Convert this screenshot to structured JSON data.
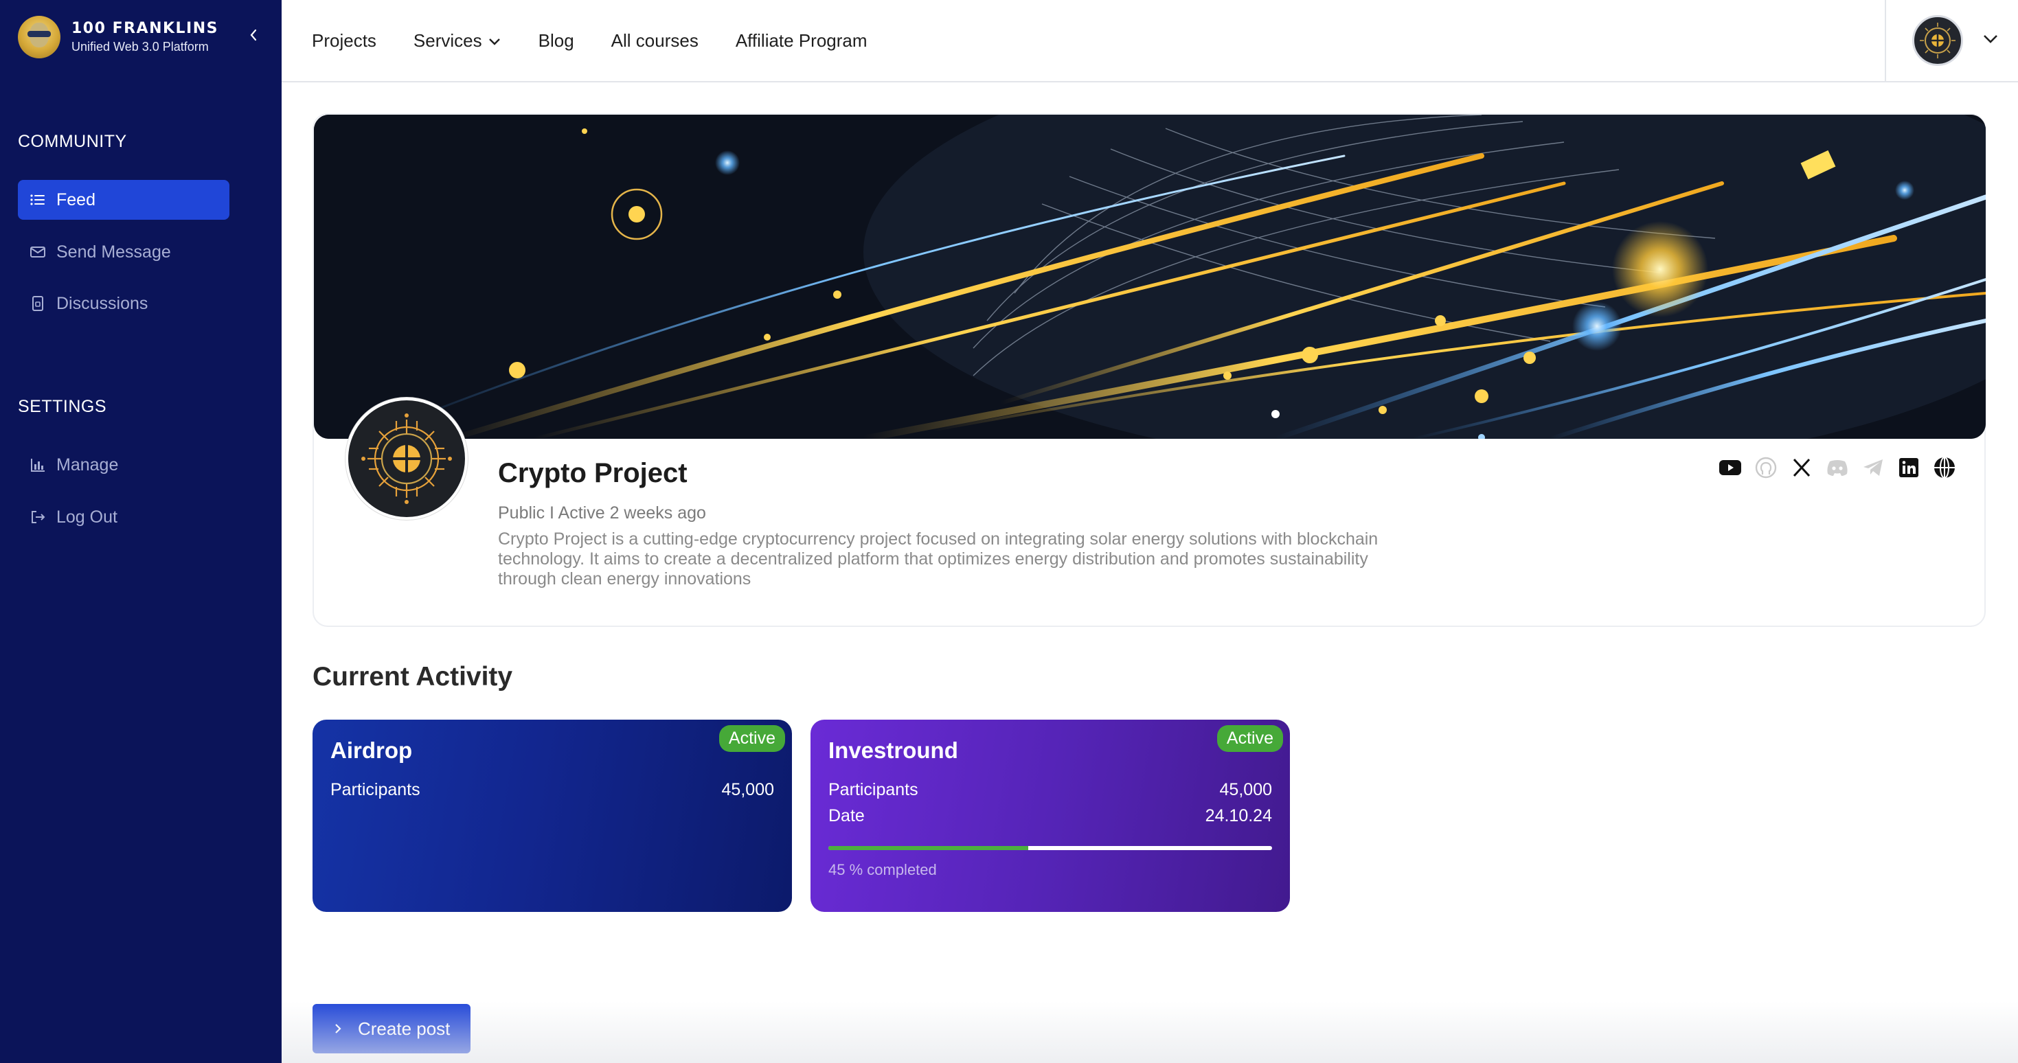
{
  "brand": {
    "title": "100 FRANKLINS",
    "subtitle": "Unified Web 3.0 Platform"
  },
  "sidebar": {
    "community_title": "COMMUNITY",
    "community_items": [
      {
        "label": "Feed",
        "icon": "list-icon",
        "active": true
      },
      {
        "label": "Send Message",
        "icon": "envelope-icon",
        "active": false
      },
      {
        "label": "Discussions",
        "icon": "document-icon",
        "active": false
      }
    ],
    "settings_title": "SETTINGS",
    "settings_items": [
      {
        "label": "Manage",
        "icon": "bar-chart-icon"
      },
      {
        "label": "Log Out",
        "icon": "logout-icon"
      }
    ]
  },
  "topnav": {
    "items": [
      "Projects",
      "Services",
      "Blog",
      "All courses",
      "Affiliate Program"
    ]
  },
  "project": {
    "name": "Crypto Project",
    "meta": "Public I Active 2 weeks ago",
    "description": "Crypto Project is a cutting-edge cryptocurrency project focused on integrating solar energy solutions with blockchain technology. It aims to create a decentralized platform that optimizes energy distribution and promotes sustainability through clean energy innovations",
    "socials": [
      "youtube-icon",
      "github-icon",
      "x-icon",
      "discord-icon",
      "telegram-icon",
      "linkedin-icon",
      "globe-icon"
    ]
  },
  "activity": {
    "title": "Current Activity",
    "cards": [
      {
        "name": "Airdrop",
        "badge": "Active",
        "rows": [
          {
            "label": "Participants",
            "value": "45,000"
          }
        ]
      },
      {
        "name": "Investround",
        "badge": "Active",
        "rows": [
          {
            "label": "Participants",
            "value": "45,000"
          },
          {
            "label": "Date",
            "value": "24.10.24"
          }
        ],
        "progress": 0.45,
        "progress_label": "45 % completed"
      }
    ]
  },
  "create_post": {
    "label": "Create post"
  },
  "colors": {
    "sidebar_bg": "#0b1459",
    "accent": "#2046d8",
    "badge_green": "#46a938",
    "invest_purple": "#5524b7"
  }
}
